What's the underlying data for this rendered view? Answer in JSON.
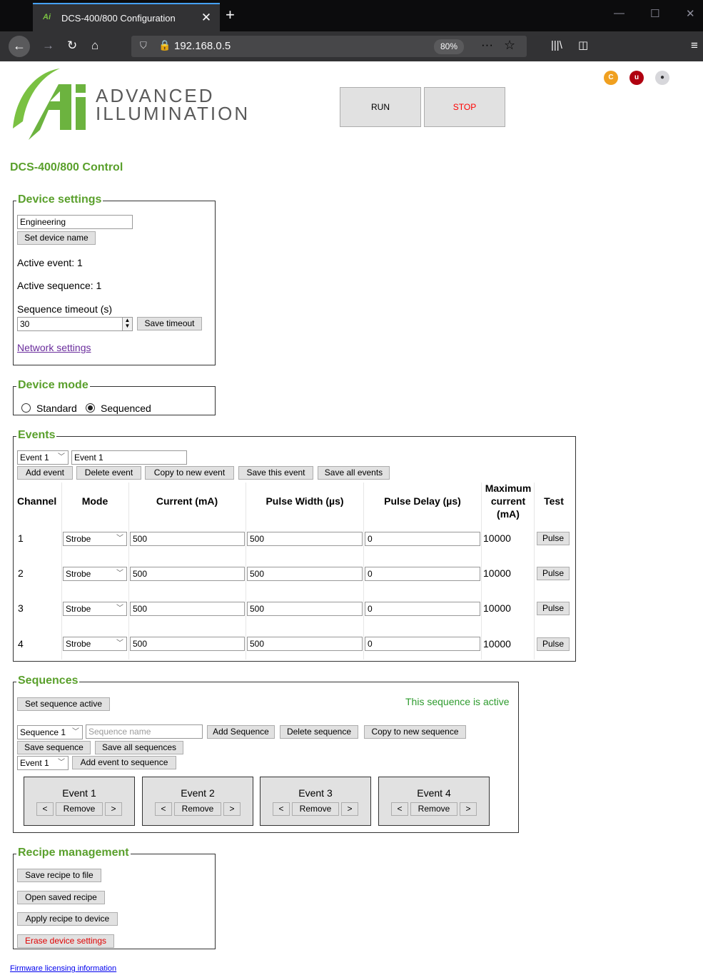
{
  "browser": {
    "tab_title": "DCS-400/800 Configuration",
    "tab_icon": "ai-favicon",
    "url": "192.168.0.5",
    "zoom": "80%"
  },
  "header": {
    "logo_line1": "ADVANCED",
    "logo_line2": "ILLUMINATION",
    "run_label": "RUN",
    "stop_label": "STOP"
  },
  "page_title": "DCS-400/800 Control",
  "device_settings": {
    "legend": "Device settings",
    "device_name": "Engineering",
    "set_name_label": "Set device name",
    "active_event": "Active event: 1",
    "active_sequence": "Active sequence: 1",
    "timeout_label": "Sequence timeout (s)",
    "timeout_value": "30",
    "save_timeout_label": "Save timeout",
    "network_link": "Network settings"
  },
  "device_mode": {
    "legend": "Device mode",
    "options": [
      "Standard",
      "Sequenced"
    ],
    "selected": "Sequenced"
  },
  "events": {
    "legend": "Events",
    "selected_event": "Event 1",
    "event_name": "Event 1",
    "buttons": [
      "Add event",
      "Delete event",
      "Copy to new event",
      "Save this event",
      "Save all events"
    ],
    "headers": {
      "channel": "Channel",
      "mode": "Mode",
      "current": "Current (mA)",
      "pulse_width": "Pulse Width (µs)",
      "pulse_delay": "Pulse Delay (µs)",
      "max_current_1": "Maximum",
      "max_current_2": "current",
      "max_current_3": "(mA)",
      "test": "Test"
    },
    "rows": [
      {
        "channel": "1",
        "mode": "Strobe",
        "current": "500",
        "pulse_width": "500",
        "pulse_delay": "0",
        "max_current": "10000",
        "test": "Pulse"
      },
      {
        "channel": "2",
        "mode": "Strobe",
        "current": "500",
        "pulse_width": "500",
        "pulse_delay": "0",
        "max_current": "10000",
        "test": "Pulse"
      },
      {
        "channel": "3",
        "mode": "Strobe",
        "current": "500",
        "pulse_width": "500",
        "pulse_delay": "0",
        "max_current": "10000",
        "test": "Pulse"
      },
      {
        "channel": "4",
        "mode": "Strobe",
        "current": "500",
        "pulse_width": "500",
        "pulse_delay": "0",
        "max_current": "10000",
        "test": "Pulse"
      }
    ]
  },
  "sequences": {
    "legend": "Sequences",
    "set_active_label": "Set sequence active",
    "active_status": "This sequence is active",
    "selected_sequence": "Sequence 1",
    "name_placeholder": "Sequence name",
    "add_label": "Add Sequence",
    "delete_label": "Delete sequence",
    "copy_label": "Copy to new sequence",
    "save_label": "Save sequence",
    "save_all_label": "Save all sequences",
    "event_select": "Event 1",
    "add_event_label": "Add event to sequence",
    "event_cards": [
      {
        "name": "Event 1",
        "prev": "<",
        "remove": "Remove",
        "next": ">"
      },
      {
        "name": "Event 2",
        "prev": "<",
        "remove": "Remove",
        "next": ">"
      },
      {
        "name": "Event 3",
        "prev": "<",
        "remove": "Remove",
        "next": ">"
      },
      {
        "name": "Event 4",
        "prev": "<",
        "remove": "Remove",
        "next": ">"
      }
    ]
  },
  "recipe": {
    "legend": "Recipe management",
    "save_file": "Save recipe to file",
    "open_saved": "Open saved recipe",
    "apply": "Apply recipe to device",
    "erase": "Erase device settings"
  },
  "footer": {
    "firmware_link": "Firmware licensing information"
  },
  "colors": {
    "accent_green": "#5aa02c",
    "stop_red": "#ff0000",
    "status_green": "#2e9b2e",
    "erase_red": "#e00000"
  }
}
